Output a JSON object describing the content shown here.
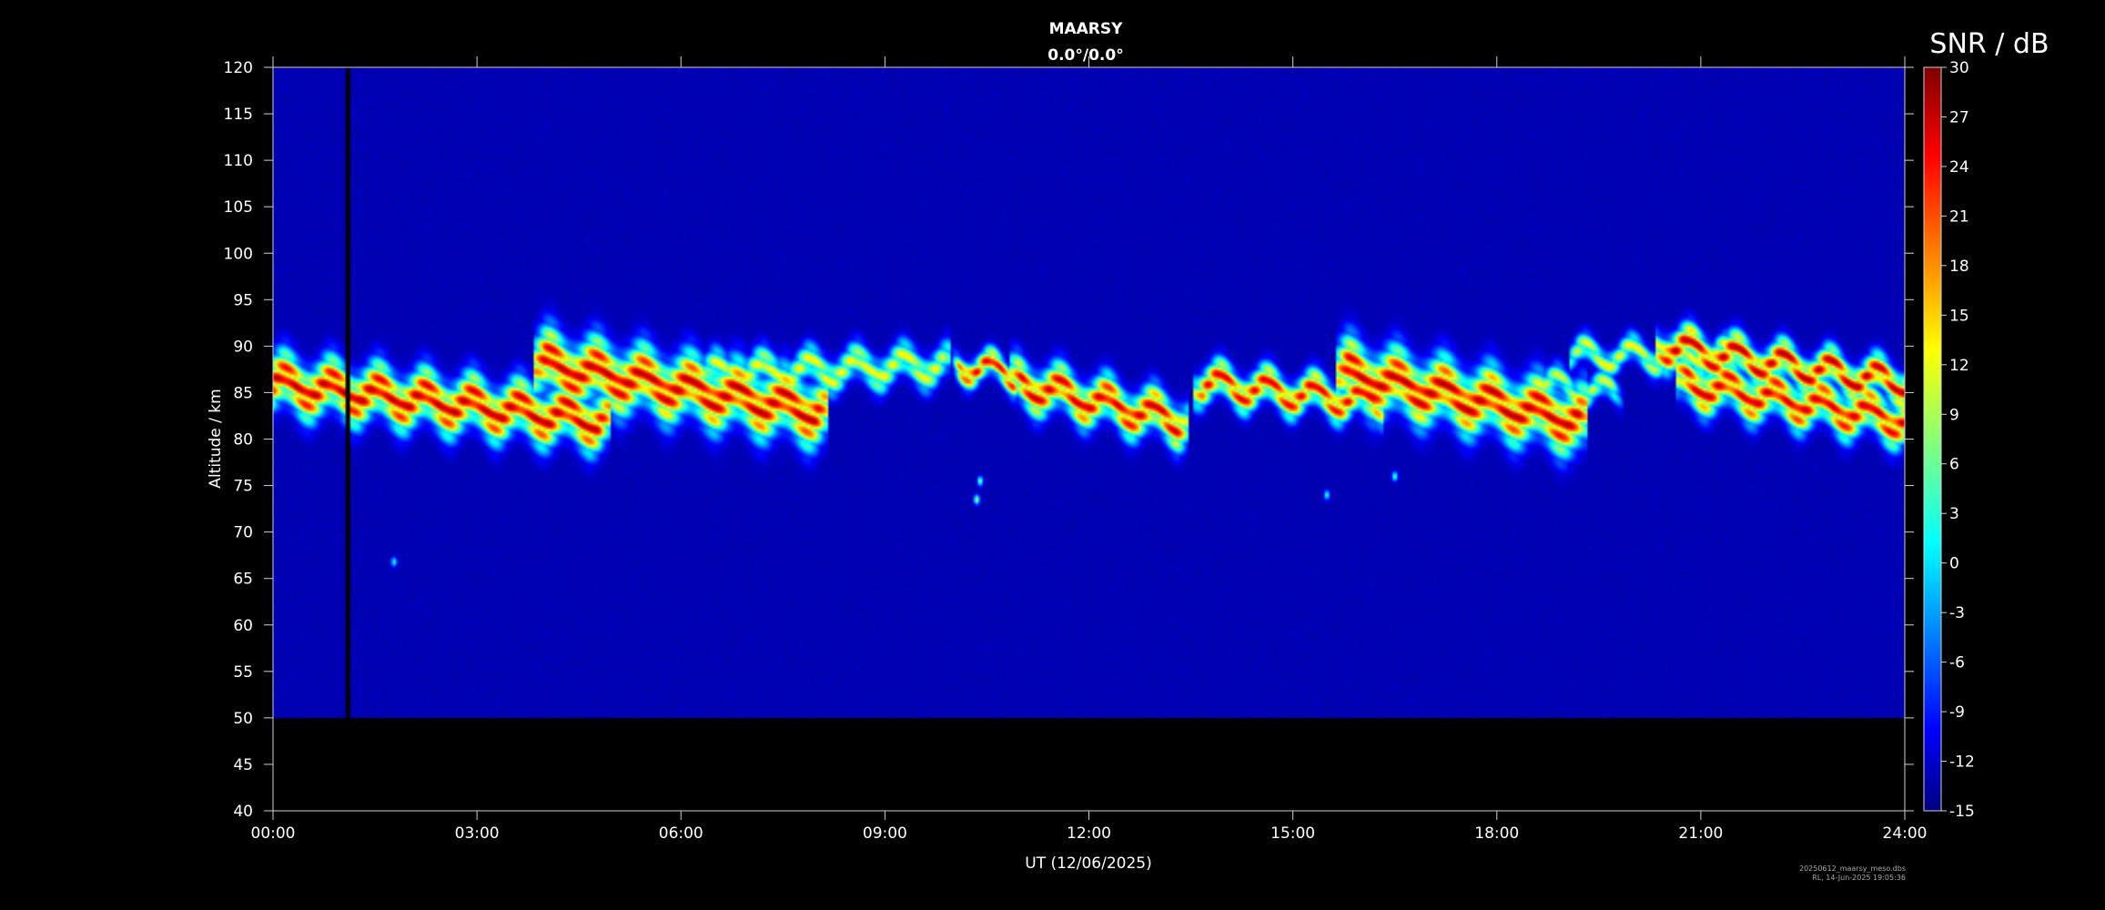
{
  "chart_data": {
    "type": "heatmap",
    "title": "MAARSY",
    "subtitle": "0.0°/0.0°",
    "xlabel": "UT (12/06/2025)",
    "ylabel": "Altitude / km",
    "x_ticks": [
      "00:00",
      "03:00",
      "06:00",
      "09:00",
      "12:00",
      "15:00",
      "18:00",
      "21:00",
      "24:00"
    ],
    "xlim_hours": [
      0,
      24
    ],
    "ylim_km": [
      40,
      120
    ],
    "y_ticks": [
      40,
      45,
      50,
      55,
      60,
      65,
      70,
      75,
      80,
      85,
      90,
      95,
      100,
      105,
      110,
      115,
      120
    ],
    "data_altitude_range_km": [
      50,
      120
    ],
    "background_snr_db": -13,
    "data_gap_hours": [
      1.05,
      1.12
    ],
    "colorbar": {
      "label": "SNR / dB",
      "min": -15,
      "max": 30,
      "ticks": [
        -15,
        -12,
        -9,
        -6,
        -3,
        0,
        3,
        6,
        9,
        12,
        15,
        18,
        21,
        24,
        27,
        30
      ],
      "colormap": "jet"
    },
    "echo_layers": [
      {
        "t_start": 0.0,
        "t_end": 4.8,
        "center_km_start": 86,
        "center_km_end": 82,
        "thickness_km": 6,
        "peak_snr_db": 28
      },
      {
        "t_start": 4.0,
        "t_end": 8.0,
        "center_km_start": 88,
        "center_km_end": 83,
        "thickness_km": 7,
        "peak_snr_db": 28
      },
      {
        "t_start": 6.5,
        "t_end": 9.8,
        "center_km_start": 87,
        "center_km_end": 88,
        "thickness_km": 4,
        "peak_snr_db": 14
      },
      {
        "t_start": 10.1,
        "t_end": 10.9,
        "center_km_start": 88,
        "center_km_end": 87,
        "thickness_km": 3,
        "peak_snr_db": 26
      },
      {
        "t_start": 11.0,
        "t_end": 13.3,
        "center_km_start": 86,
        "center_km_end": 82,
        "thickness_km": 5,
        "peak_snr_db": 27
      },
      {
        "t_start": 13.7,
        "t_end": 16.2,
        "center_km_start": 86,
        "center_km_end": 84,
        "thickness_km": 4,
        "peak_snr_db": 26
      },
      {
        "t_start": 15.8,
        "t_end": 19.2,
        "center_km_start": 87,
        "center_km_end": 82,
        "thickness_km": 7,
        "peak_snr_db": 28
      },
      {
        "t_start": 18.5,
        "t_end": 19.7,
        "center_km_start": 86,
        "center_km_end": 85,
        "thickness_km": 3,
        "peak_snr_db": 12
      },
      {
        "t_start": 19.2,
        "t_end": 21.5,
        "center_km_start": 89,
        "center_km_end": 89,
        "thickness_km": 3,
        "peak_snr_db": 14
      },
      {
        "t_start": 20.5,
        "t_end": 24.0,
        "center_km_start": 90,
        "center_km_end": 86,
        "thickness_km": 4,
        "peak_snr_db": 28
      },
      {
        "t_start": 20.8,
        "t_end": 24.0,
        "center_km_start": 86,
        "center_km_end": 82,
        "thickness_km": 5,
        "peak_snr_db": 27
      }
    ],
    "isolated_echoes": [
      {
        "t": 10.35,
        "km": 73.5,
        "snr_db": 10
      },
      {
        "t": 10.4,
        "km": 75.5,
        "snr_db": 8
      },
      {
        "t": 16.5,
        "km": 76.0,
        "snr_db": 6
      },
      {
        "t": 15.5,
        "km": 74.0,
        "snr_db": 4
      },
      {
        "t": 1.78,
        "km": 66.8,
        "snr_db": 4
      }
    ]
  },
  "footer": {
    "line1": "20250612_maarsy_meso.dbs",
    "line2": "RL, 14-Jun-2025 19:05:36"
  }
}
